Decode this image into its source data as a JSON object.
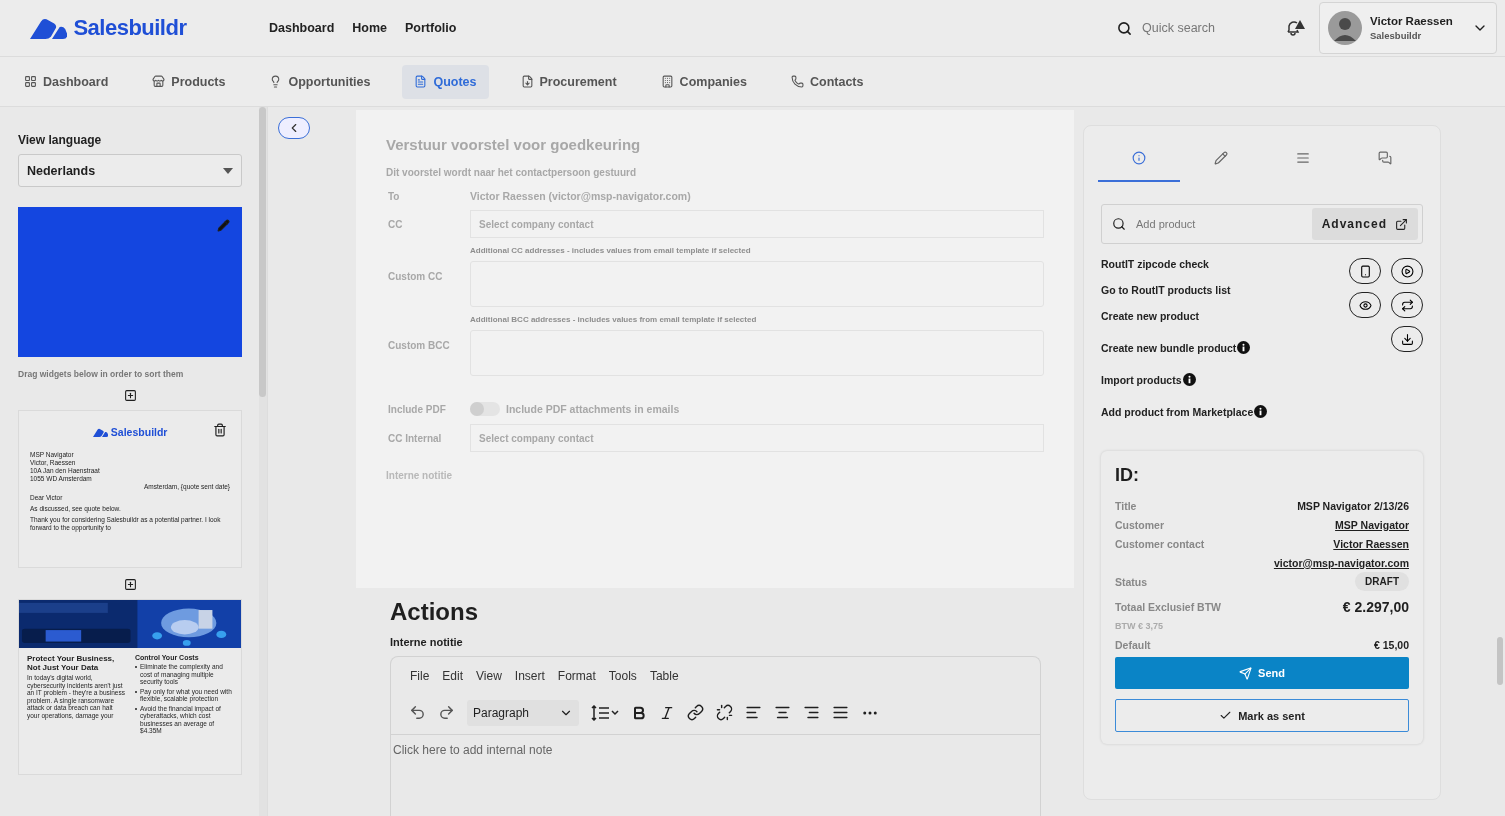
{
  "brand": {
    "name": "Salesbuildr"
  },
  "top_nav": [
    "Dashboard",
    "Home",
    "Portfolio"
  ],
  "search": {
    "placeholder": "Quick search"
  },
  "user": {
    "name": "Victor Raessen",
    "company": "Salesbuildr"
  },
  "tabs": [
    {
      "label": "Dashboard",
      "selected": false
    },
    {
      "label": "Products",
      "selected": false
    },
    {
      "label": "Opportunities",
      "selected": false
    },
    {
      "label": "Quotes",
      "selected": true
    },
    {
      "label": "Procurement",
      "selected": false
    },
    {
      "label": "Companies",
      "selected": false
    },
    {
      "label": "Contacts",
      "selected": false
    }
  ],
  "sidebar": {
    "language_label": "View language",
    "language": "Nederlands",
    "hint": "Drag widgets below in order to sort them",
    "letter": {
      "brand": "Salesbuildr",
      "address": [
        "MSP Navigator",
        "Victor, Raessen",
        "10A Jan den Haenstraat",
        "1055 WD Amsterdam"
      ],
      "date": "Amsterdam, {quote sent date}",
      "lines": [
        "Dear Victor",
        "As discussed, see quote below.",
        "Thank you for considering Salesbuildr as a potential partner. I look forward to the opportunity to"
      ]
    },
    "brochure": {
      "heading": "Protect Your Business, Not Just Your Data",
      "body": "In today's digital world, cybersecurity incidents aren't just an IT problem - they're a business problem. A single ransomware attack or data breach can halt your operations, damage your",
      "side_heading": "Control Your Costs",
      "bullets": [
        "Eliminate the complexity and cost of managing multiple security tools",
        "Pay only for what you need with flexible, scalable protection",
        "Avoid the financial impact of cyberattacks, which cost businesses an average of $4.35M"
      ]
    }
  },
  "modal": {
    "title": "Verstuur voorstel voor goedkeuring",
    "subtitle": "Dit voorstel wordt naar het contactpersoon gestuurd",
    "fields": [
      {
        "kind": "text",
        "label": "To",
        "value": "Victor Raessen (victor@msp-navigator.com)"
      },
      {
        "kind": "select",
        "label": "CC",
        "placeholder": "Select company contact"
      },
      {
        "kind": "textarea",
        "label": "Custom CC",
        "hint": "Additional CC addresses - includes values from email template if selected"
      },
      {
        "kind": "textarea",
        "label": "Custom BCC",
        "hint": "Additional BCC addresses - includes values from email template if selected"
      },
      {
        "kind": "toggle",
        "label": "Include PDF",
        "value": "Include PDF attachments in emails",
        "on": false
      },
      {
        "kind": "select",
        "label": "CC Internal",
        "placeholder": "Select company contact"
      }
    ],
    "note_label": "Interne notitie"
  },
  "actions": {
    "title": "Actions",
    "note_label": "Interne notitie",
    "menu": [
      "File",
      "Edit",
      "View",
      "Insert",
      "Format",
      "Tools",
      "Table"
    ],
    "block_format": "Paragraph",
    "placeholder": "Click here to add internal note"
  },
  "panel": {
    "tabs": [
      {
        "selected": true
      },
      {
        "selected": false
      },
      {
        "selected": false
      },
      {
        "selected": false
      }
    ],
    "product_search": {
      "placeholder": "Add product"
    },
    "advanced": "Advanced",
    "product_actions": [
      {
        "label": "RoutIT zipcode check",
        "info": false
      },
      {
        "label": "Go to RoutIT products list",
        "info": false
      },
      {
        "label": "Create new product",
        "info": false
      },
      {
        "label": "Create new bundle product",
        "info": true
      },
      {
        "label": "Import products",
        "info": true
      },
      {
        "label": "Add product from Marketplace",
        "info": true
      }
    ],
    "summary": {
      "id_label": "ID:",
      "fields": [
        {
          "label": "Title",
          "value": "MSP Navigator 2/13/26",
          "link": false
        },
        {
          "label": "Customer",
          "value": "MSP Navigator",
          "link": true
        },
        {
          "label": "Customer contact",
          "value": "Victor Raessen",
          "link": true
        },
        {
          "value": "victor@msp-navigator.com",
          "link": true
        }
      ],
      "status_label": "Status",
      "status": "DRAFT",
      "total_label": "Totaal Exclusief BTW",
      "total": "€ 2.297,00",
      "vat": "BTW € 3,75",
      "default_label": "Default",
      "default_value": "€ 15,00",
      "send": "Send",
      "mark_sent": "Mark as sent"
    }
  }
}
